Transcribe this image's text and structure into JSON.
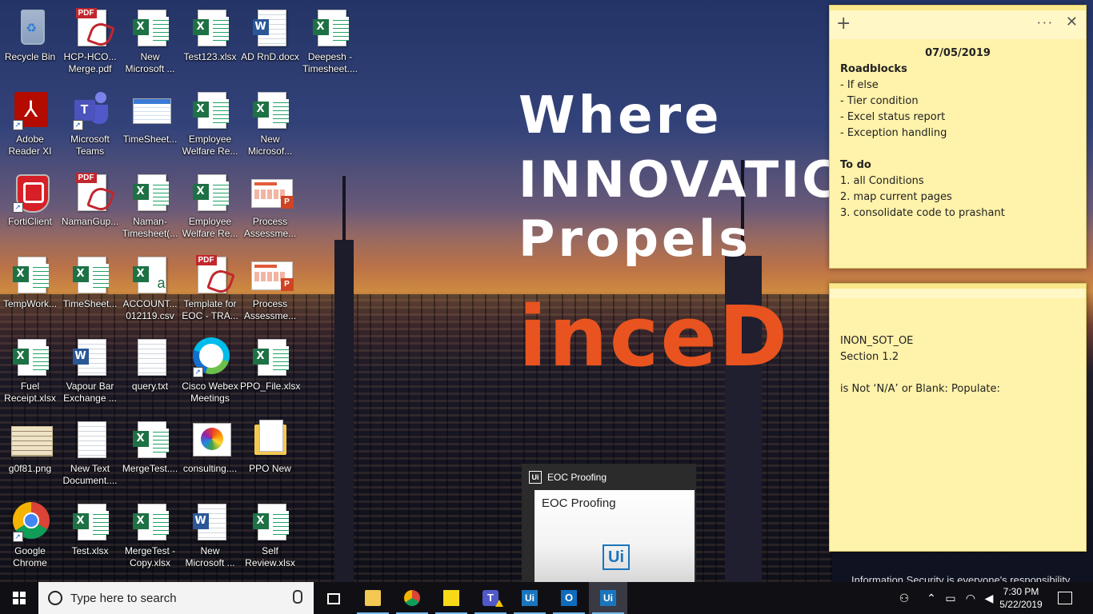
{
  "wallpaper": {
    "line1": "Where",
    "line2": "INNOVATIC",
    "line3": "Propels",
    "brand": "inceD",
    "footer": "Information Security is everyone's responsibility",
    "brand_color": "#e8531f"
  },
  "desktop_icons": [
    {
      "label": "Recycle Bin",
      "icon": "recycle-bin-icon"
    },
    {
      "label": "HCP-HCO... Merge.pdf",
      "icon": "pdf-file-icon"
    },
    {
      "label": "New Microsoft ...",
      "icon": "excel-file-icon"
    },
    {
      "label": "Test123.xlsx",
      "icon": "excel-file-icon"
    },
    {
      "label": "AD RnD.docx",
      "icon": "word-file-icon"
    },
    {
      "label": "Deepesh - Timesheet....",
      "icon": "excel-file-icon"
    },
    {
      "label": "Adobe Reader XI",
      "icon": "adobe-reader-icon"
    },
    {
      "label": "Microsoft Teams",
      "icon": "teams-icon"
    },
    {
      "label": "TimeSheet...",
      "icon": "spreadsheet-thumbnail-icon"
    },
    {
      "label": "Employee Welfare Re...",
      "icon": "excel-file-icon"
    },
    {
      "label": "New Microsof...",
      "icon": "excel-file-icon"
    },
    {
      "label": "FortiClient",
      "icon": "forticlient-icon"
    },
    {
      "label": "NamanGup...",
      "icon": "pdf-file-icon"
    },
    {
      "label": "Naman-Timesheet(...",
      "icon": "excel-file-icon"
    },
    {
      "label": "Employee Welfare Re...",
      "icon": "excel-file-icon"
    },
    {
      "label": "Process Assessme...",
      "icon": "powerpoint-file-icon"
    },
    {
      "label": "TempWork...",
      "icon": "excel-file-icon"
    },
    {
      "label": "TimeSheet...",
      "icon": "excel-file-icon"
    },
    {
      "label": "ACCOUNT... 012119.csv",
      "icon": "csv-file-icon"
    },
    {
      "label": "Template for EOC - TRA...",
      "icon": "pdf-file-icon"
    },
    {
      "label": "Process Assessme...",
      "icon": "powerpoint-file-icon"
    },
    {
      "label": "Fuel Receipt.xlsx",
      "icon": "excel-file-icon"
    },
    {
      "label": "Vapour Bar Exchange ...",
      "icon": "word-file-icon"
    },
    {
      "label": "query.txt",
      "icon": "text-file-icon"
    },
    {
      "label": "Cisco Webex Meetings",
      "icon": "webex-icon"
    },
    {
      "label": "PPO_File.xlsx",
      "icon": "excel-file-icon"
    },
    {
      "label": "g0f81.png",
      "icon": "image-file-icon"
    },
    {
      "label": "New Text Document....",
      "icon": "text-file-icon"
    },
    {
      "label": "MergeTest....",
      "icon": "excel-file-icon"
    },
    {
      "label": "consulting....",
      "icon": "color-wheel-icon"
    },
    {
      "label": "PPO New",
      "icon": "folder-icon"
    },
    {
      "label": "Google Chrome",
      "icon": "chrome-icon"
    },
    {
      "label": "Test.xlsx",
      "icon": "excel-file-icon"
    },
    {
      "label": "MergeTest - Copy.xlsx",
      "icon": "excel-file-icon"
    },
    {
      "label": "New Microsoft ...",
      "icon": "word-file-icon"
    },
    {
      "label": "Self Review.xlsx",
      "icon": "excel-file-icon"
    }
  ],
  "sticky_note_1": {
    "date": "07/05/2019",
    "heading1": "Roadblocks",
    "roadblocks": [
      "- If else",
      "- Tier condition",
      "- Excel status report",
      "- Exception handling"
    ],
    "heading2": "To do",
    "todos": [
      "1. all Conditions",
      "2. map current pages",
      "3. consolidate code to prashant"
    ],
    "add_icon": "+",
    "more_icon": "···",
    "close_icon": "✕"
  },
  "sticky_note_2": {
    "line1": "INON_SOT_OE",
    "line2": "Section 1.2",
    "line3": "is Not ‘N/A’ or Blank: Populate:"
  },
  "preview": {
    "title": "EOC Proofing",
    "content_title": "EOC Proofing",
    "logo": "Ui"
  },
  "taskbar": {
    "search_placeholder": "Type here to search",
    "teams_letter": "T",
    "uipath_label": "Ui",
    "outlook_label": "O",
    "time": "7:30 PM",
    "date": "5/22/2019"
  }
}
